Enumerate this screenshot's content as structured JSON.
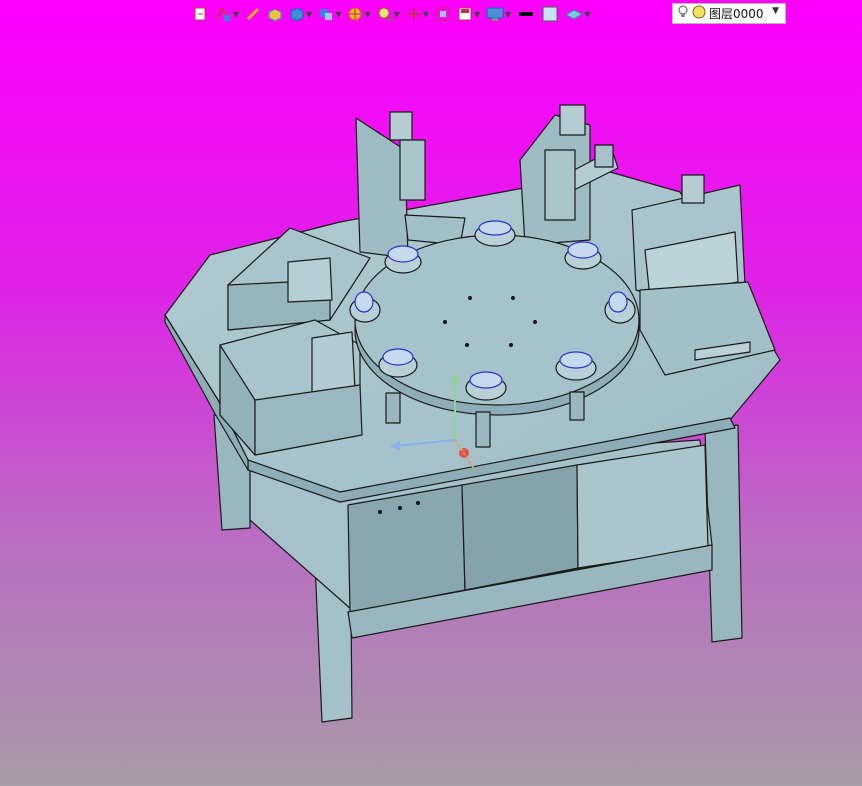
{
  "toolbar": {
    "layer_name": "图层0000",
    "colors": {
      "line_color": "#000000",
      "fill_color": "#c6e2f5",
      "background_top": "#ff00ff",
      "background_bottom": "#a89aa6",
      "model_fill": "#a9c4cc",
      "model_edge": "#1a1a1a"
    },
    "icons": [
      "new-document-icon",
      "sketch-icon",
      "pencil-icon",
      "box-icon",
      "solid-cube-icon",
      "feature-icon",
      "spoke-wheel-icon",
      "zoom-icon",
      "pan-icon",
      "fit-view-icon",
      "save-icon",
      "display-icon",
      "line-style-icon",
      "fill-color-icon",
      "render-style-icon",
      "lightbulb-icon",
      "layer-color-icon"
    ]
  }
}
